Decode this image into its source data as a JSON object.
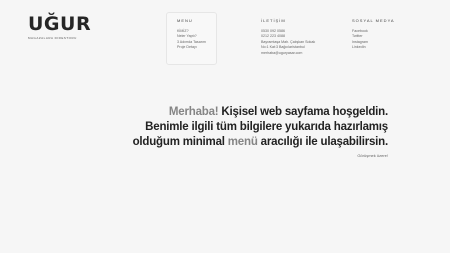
{
  "logo": {
    "word": "UĞUR",
    "tagline": "MAGAZALARA DIRESTORU"
  },
  "menu": {
    "title": "MENU",
    "items": [
      "KİMİZ?",
      "Neler Yaptı?",
      "3 Adımda Tasarım",
      "Proje Detayı"
    ]
  },
  "contact": {
    "title": "İLETİŞİM",
    "items": [
      "0530 092 0586",
      "0212 223 4088",
      "Bayramtaşa Mah. Çalışkan Sokak",
      "No:1 Kat:3 Bağcılar/stanbul",
      "merhaba@uguryasar.com"
    ]
  },
  "social": {
    "title": "SOSYAL MEDYA",
    "items": [
      "Facebook",
      "Twitter",
      "Instagram",
      "LinkedIn"
    ]
  },
  "hero": {
    "line1_accent": "Merhaba!",
    "line1_rest": " Kişisel web sayfama hoşgeldin.",
    "line2": "Benimle ilgili tüm bilgilere yukarıda hazırlamış",
    "line3_pre": "olduğum minimal ",
    "line3_accent": "menü",
    "line3_post": " aracılığı ile ulaşabilirsin.",
    "cta": "Görüşmek üzere!"
  },
  "colors": {
    "background": "#f6f6f6",
    "text": "#222222",
    "accent": "#858585"
  }
}
